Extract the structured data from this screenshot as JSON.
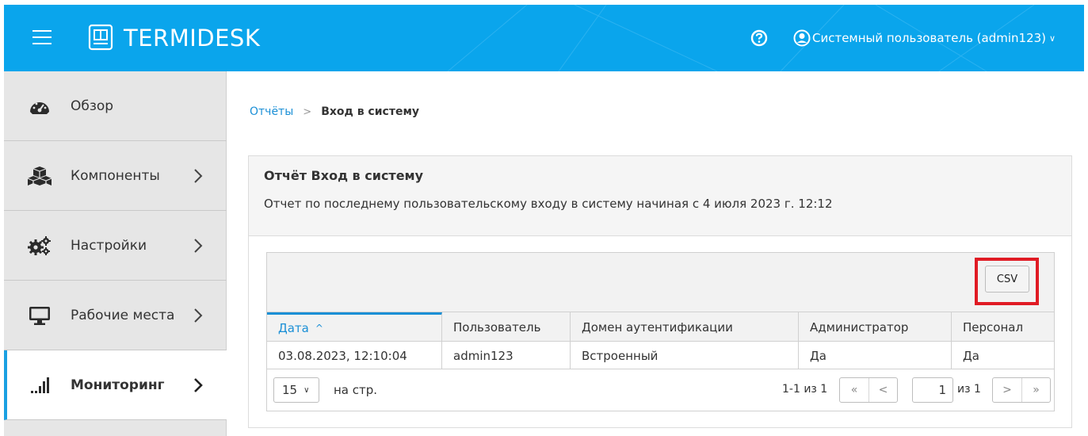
{
  "header": {
    "logo_text": "TERMIDESK",
    "user_label": "Системный пользователь (admin123)",
    "brand_color": "#0aa5ec"
  },
  "icons": {
    "menu": "hamburger-icon",
    "logo": "monitor-logo-icon",
    "help": "question-circle-icon",
    "user": "user-circle-icon"
  },
  "sidebar": {
    "items": [
      {
        "label": "Обзор",
        "icon": "dashboard-icon"
      },
      {
        "label": "Компоненты",
        "icon": "cubes-icon"
      },
      {
        "label": "Настройки",
        "icon": "gears-icon"
      },
      {
        "label": "Рабочие места",
        "icon": "desktop-icon"
      },
      {
        "label": "Мониторинг",
        "icon": "signal-bars-icon",
        "active": true
      }
    ]
  },
  "breadcrumb": {
    "parent": "Отчёты",
    "separator": ">",
    "current": "Вход в систему"
  },
  "report": {
    "title": "Отчёт Вход в систему",
    "description": "Отчет по последнему пользовательскому входу в систему начиная с 4 июля 2023 г. 12:12"
  },
  "toolbar": {
    "csv_label": "CSV",
    "highlight_color": "#e01b24"
  },
  "table": {
    "columns": [
      "Дата",
      "Пользователь",
      "Домен аутентификации",
      "Администратор",
      "Персонал"
    ],
    "sort_indicator": "^",
    "rows": [
      [
        "03.08.2023, 12:10:04",
        "admin123",
        "Встроенный",
        "Да",
        "Да"
      ]
    ]
  },
  "pager": {
    "page_size": "15",
    "per_page_label": "на стр.",
    "range": "1-1 из 1",
    "first": "«",
    "prev": "<",
    "current_page": "1",
    "of_label": "из 1",
    "next": ">",
    "last": "»"
  }
}
